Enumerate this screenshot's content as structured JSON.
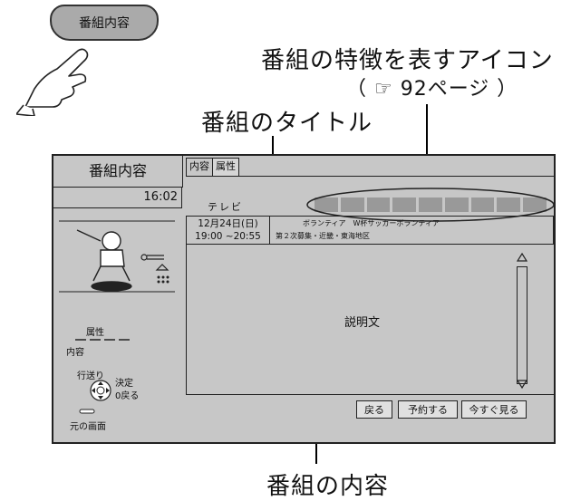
{
  "key_tag": {
    "label": "番組内容"
  },
  "callouts": {
    "icon_callout": "番組の特徴を表すアイコン",
    "icon_ref": "（ ☞ 92ページ ）",
    "title_callout": "番組のタイトル",
    "content_callout": "番組の内容"
  },
  "screen": {
    "left_title": "番組内容",
    "time": "16:02",
    "tabs": [
      {
        "label": "内容"
      },
      {
        "label": "属性"
      }
    ],
    "channel": "テレビ",
    "program_date": "12月24日(日)",
    "program_time": "19:00 ~20:55",
    "program_title_line1": "ボランティア　W杯サッカーボランティア",
    "program_title_line2": "第２次募集・近畿・東海地区",
    "description": "説明文",
    "legend": {
      "attribute": "属性",
      "content": "内容",
      "nav": "行送り",
      "ok": "決定",
      "back": "0戻る",
      "home": "元の画面"
    },
    "buttons": {
      "back": "戻る",
      "reserve": "予約する",
      "watch_now": "今すぐ見る"
    }
  }
}
